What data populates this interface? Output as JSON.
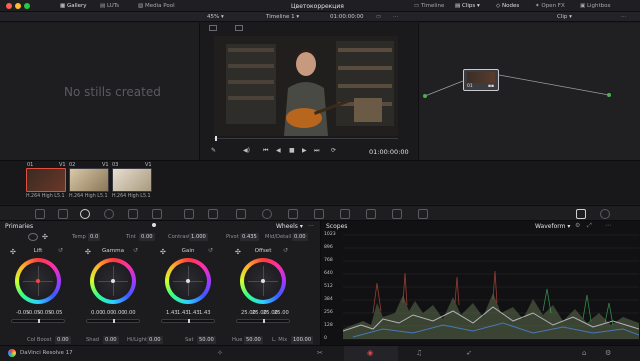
{
  "top_bar": {
    "tabs": [
      {
        "label": "Gallery",
        "icon": "gallery-icon"
      },
      {
        "label": "LUTs",
        "icon": "luts-icon"
      },
      {
        "label": "Media Pool",
        "icon": "media-pool-icon"
      }
    ],
    "title": "Цветокоррекция",
    "right_tabs": [
      {
        "label": "Timeline",
        "icon": "timeline-icon"
      },
      {
        "label": "Clips",
        "icon": "clips-icon"
      },
      {
        "label": "Nodes",
        "icon": "nodes-icon"
      },
      {
        "label": "Open FX",
        "icon": "open-fx-icon"
      },
      {
        "label": "Lightbox",
        "icon": "lightbox-icon"
      }
    ]
  },
  "viewer_bar": {
    "zoom": "45%",
    "timeline_name": "Timeline 1",
    "timecode": "01:00:00:00",
    "mode": "Clip"
  },
  "gallery": {
    "empty_text": "No stills created"
  },
  "viewer": {
    "timecode": "01:00:00:00"
  },
  "node": {
    "label": "01"
  },
  "clips": [
    {
      "num": "01",
      "track": "V1",
      "codec": "H.264 High L5.1"
    },
    {
      "num": "02",
      "track": "V1",
      "codec": "H.264 High L5.1"
    },
    {
      "num": "03",
      "track": "V1",
      "codec": "H.264 High L5.1"
    }
  ],
  "primaries": {
    "title": "Primaries",
    "mode": "Wheels",
    "params": [
      {
        "label": "Temp",
        "value": "0.0"
      },
      {
        "label": "Tint",
        "value": "0.00"
      },
      {
        "label": "Contrast",
        "value": "1.000"
      },
      {
        "label": "Pivot",
        "value": "0.435"
      },
      {
        "label": "Mid/Detail",
        "value": "0.00"
      }
    ],
    "wheels": [
      {
        "name": "Lift",
        "values": [
          "-0.05",
          "-0.05",
          "-0.05",
          "-0.05"
        ],
        "dot": "#ff4040"
      },
      {
        "name": "Gamma",
        "values": [
          "0.00",
          "0.00",
          "0.00",
          "0.00"
        ],
        "dot": "#e0e0e0"
      },
      {
        "name": "Gain",
        "values": [
          "1.43",
          "1.43",
          "1.43",
          "1.43"
        ],
        "dot": "#e0e0e0"
      },
      {
        "name": "Offset",
        "values": [
          "25.00",
          "25.00",
          "25.00",
          "25.00"
        ],
        "dot": "#e0e0e0"
      }
    ],
    "bottom_params": [
      {
        "label": "Col Boost",
        "value": "0.00"
      },
      {
        "label": "Shad",
        "value": "0.00"
      },
      {
        "label": "Hi/Light",
        "value": "0.00"
      },
      {
        "label": "Sat",
        "value": "50.00"
      },
      {
        "label": "Hue",
        "value": "50.00"
      },
      {
        "label": "L. Mix",
        "value": "100.00"
      }
    ]
  },
  "scopes": {
    "title": "Scopes",
    "mode": "Waveform",
    "scale": [
      "1023",
      "896",
      "768",
      "640",
      "512",
      "384",
      "256",
      "128",
      "0"
    ]
  },
  "status": {
    "app_name": "DaVinci Resolve 17"
  }
}
